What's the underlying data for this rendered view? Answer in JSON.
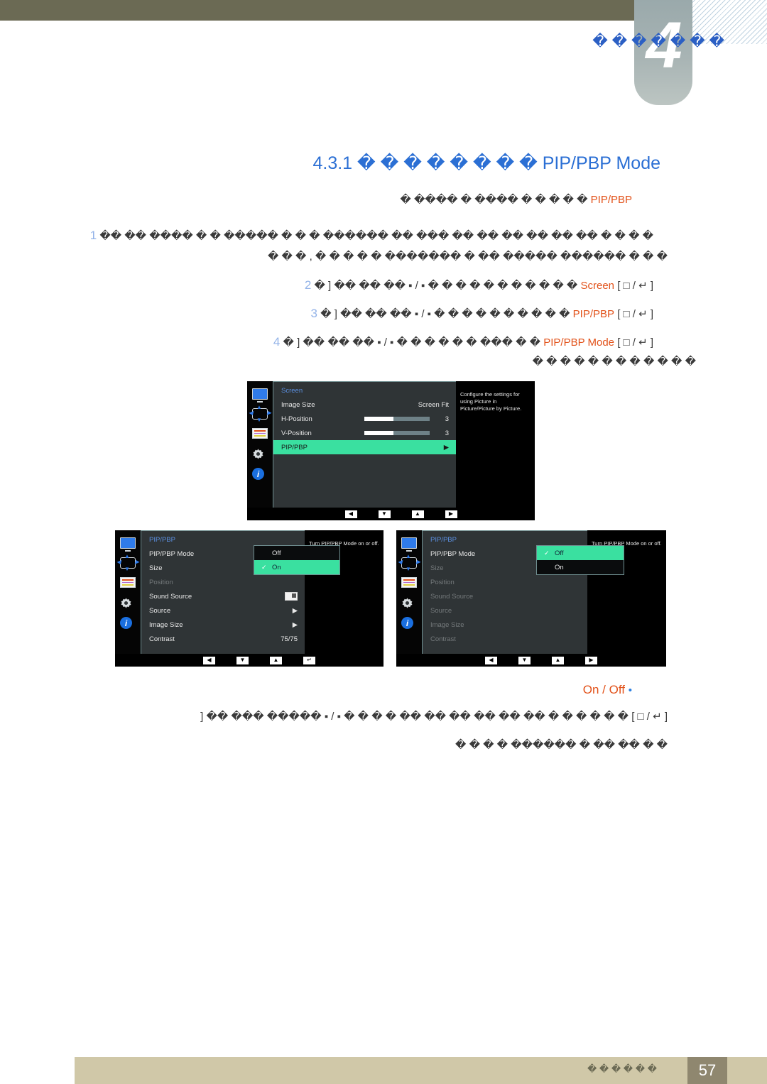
{
  "header": {
    "chapter_number": "4",
    "chapter_title": "� � � � � � �"
  },
  "section": {
    "number": "4.3.1",
    "term": "PIP/PBP Mode",
    "title_boxes": "� � � � � � � �"
  },
  "body": {
    "intro_term": "PIP/PBP",
    "intro_text": "� � � � � ���� � ���� �",
    "step1_line1": "� � � � �� �� �� �� �� �� ��� �� ������ � � � ����� � � ���� �� ��",
    "step1_line2": "� � � ������ ����� �� � ������� � � � � � , � � �",
    "step1_num": "1",
    "step2_keys": "[ □ / ↵ ]",
    "step2_term": "Screen",
    "step2_text": "� � � � � � � � � � � ▪ / ▪ �� �� �� [ �",
    "step2_num": "2",
    "step3_keys": "[ □ / ↵ ]",
    "step3_term": "PIP/PBP",
    "step3_text": "� � � � � � � � � � ▪ / ▪ �� �� �� [ �",
    "step3_num": "3",
    "step4_keys": "[ □ / ↵ ]",
    "step4_term": "PIP/PBP Mode",
    "step4_text": "� � ��� � � � � � � ▪ / ▪ �� �� �� [ �",
    "step4_num": "4",
    "step4_line2": "� � � � � � � � � � � �",
    "onoff_label": "On / Off",
    "onoff_bullet": "•",
    "step5_keys": "[ □ / ↵ ]",
    "step5_text": "� � � � � � �� �� �� �� �� �� � � � � ▪ / ▪ ����� ��� �� [",
    "step5_line2": "� � �� �� � ������ � � � �"
  },
  "osd_screen": {
    "title": "Screen",
    "help": "Configure the settings for using Picture in Picture/Picture by Picture.",
    "rows": [
      {
        "label": "Image Size",
        "value": "Screen Fit",
        "kind": "value",
        "state": "normal"
      },
      {
        "label": "H-Position",
        "value": "3",
        "kind": "slider",
        "state": "normal"
      },
      {
        "label": "V-Position",
        "value": "3",
        "kind": "slider",
        "state": "normal"
      },
      {
        "label": "PIP/PBP",
        "value": "▶",
        "kind": "arrow",
        "state": "selected"
      }
    ],
    "nav": [
      "◀",
      "▼",
      "▲",
      "▶"
    ]
  },
  "osd_on": {
    "title": "PIP/PBP",
    "help": "Turn PIP/PBP Mode on or off.",
    "rows": [
      {
        "label": "PIP/PBP Mode",
        "value": "",
        "kind": "none",
        "state": "normal"
      },
      {
        "label": "Size",
        "value": "",
        "kind": "none",
        "state": "normal"
      },
      {
        "label": "Position",
        "value": "",
        "kind": "none",
        "state": "dim"
      },
      {
        "label": "Sound Source",
        "value": "",
        "kind": "pip",
        "state": "normal"
      },
      {
        "label": "Source",
        "value": "▶",
        "kind": "arrow",
        "state": "normal"
      },
      {
        "label": "Image Size",
        "value": "▶",
        "kind": "arrow",
        "state": "normal"
      },
      {
        "label": "Contrast",
        "value": "75/75",
        "kind": "value",
        "state": "normal"
      }
    ],
    "popup": [
      {
        "label": "Off",
        "checked": false,
        "highlighted": false
      },
      {
        "label": "On",
        "checked": true,
        "highlighted": true
      }
    ],
    "nav": [
      "◀",
      "▼",
      "▲",
      "↵"
    ]
  },
  "osd_off": {
    "title": "PIP/PBP",
    "help": "Turn PIP/PBP Mode on or off.",
    "rows": [
      {
        "label": "PIP/PBP Mode",
        "value": "",
        "kind": "none",
        "state": "normal"
      },
      {
        "label": "Size",
        "value": "",
        "kind": "none",
        "state": "dim"
      },
      {
        "label": "Position",
        "value": "",
        "kind": "none",
        "state": "dim"
      },
      {
        "label": "Sound Source",
        "value": "",
        "kind": "none",
        "state": "dim"
      },
      {
        "label": "Source",
        "value": "",
        "kind": "none",
        "state": "dim"
      },
      {
        "label": "Image Size",
        "value": "",
        "kind": "none",
        "state": "dim"
      },
      {
        "label": "Contrast",
        "value": "",
        "kind": "none",
        "state": "dim"
      }
    ],
    "popup": [
      {
        "label": "Off",
        "checked": true,
        "highlighted": true
      },
      {
        "label": "On",
        "checked": false,
        "highlighted": false
      }
    ],
    "nav": [
      "◀",
      "▼",
      "▲",
      "▶"
    ]
  },
  "footer": {
    "text": "� � � � � �",
    "page": "57"
  },
  "colors": {
    "header_bar": "#6b6a54",
    "chapter_tab": "#a8b4b4",
    "accent_blue": "#2b6fd4",
    "accent_orange": "#e2521a",
    "osd_highlight": "#3ae0a0",
    "footer_bar": "#d0c8a8",
    "page_box": "#8f876f"
  }
}
